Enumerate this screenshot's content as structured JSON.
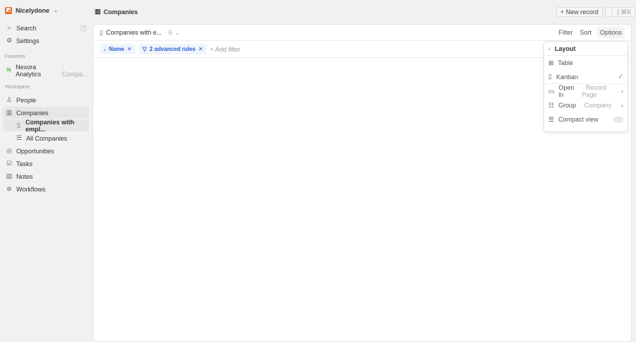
{
  "workspace": "Nicelydone",
  "sidebar": {
    "search": "Search",
    "search_kbd": "/",
    "settings": "Settings",
    "favorites_label": "Favorites",
    "favorite": {
      "badge": "N",
      "name": "Nexora Analytics",
      "sub": "· Compa..."
    },
    "workspace_label": "Workspace",
    "items": [
      "People",
      "Companies",
      "Companies with empl...",
      "All Companies",
      "Opportunities",
      "Tasks",
      "Notes",
      "Workflows"
    ]
  },
  "header": {
    "title": "Companies",
    "new_record": "+ New record",
    "more": "⋮ | ⌘K"
  },
  "view": {
    "name": "Companies with e...",
    "count": "· 6",
    "filter": "Filter",
    "sort": "Sort",
    "options": "Options"
  },
  "filters": {
    "sort_chip": "Name",
    "advanced_chip": "2 advanced rules",
    "add_filter": "Add filter"
  },
  "menu": {
    "title": "Layout",
    "table": "Table",
    "kanban": "Kanban",
    "open_in": "Open in",
    "open_in_value": "· Record Page",
    "group": "Group",
    "group_value": "· Company",
    "compact": "Compact view"
  }
}
